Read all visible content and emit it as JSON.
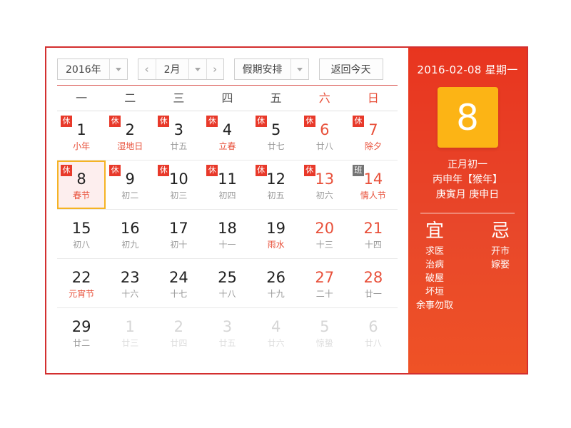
{
  "toolbar": {
    "year_value": "2016年",
    "year_caret": "caret-down-icon",
    "prev_label": "‹",
    "month_value": "2月",
    "month_caret": "caret-down-icon",
    "next_label": "›",
    "holiday_value": "假期安排",
    "holiday_caret": "caret-down-icon",
    "today_label": "返回今天"
  },
  "week_header": [
    {
      "label": "一",
      "weekend": false
    },
    {
      "label": "二",
      "weekend": false
    },
    {
      "label": "三",
      "weekend": false
    },
    {
      "label": "四",
      "weekend": false
    },
    {
      "label": "五",
      "weekend": false
    },
    {
      "label": "六",
      "weekend": true
    },
    {
      "label": "日",
      "weekend": true
    }
  ],
  "weeks": [
    [
      {
        "num": "1",
        "lunar": "小年",
        "lunar_fest": true,
        "badge": "休",
        "badge_type": "rest",
        "weekend": false,
        "other": false,
        "selected": false
      },
      {
        "num": "2",
        "lunar": "湿地日",
        "lunar_fest": true,
        "badge": "休",
        "badge_type": "rest",
        "weekend": false,
        "other": false,
        "selected": false
      },
      {
        "num": "3",
        "lunar": "廿五",
        "lunar_fest": false,
        "badge": "休",
        "badge_type": "rest",
        "weekend": false,
        "other": false,
        "selected": false
      },
      {
        "num": "4",
        "lunar": "立春",
        "lunar_fest": true,
        "badge": "休",
        "badge_type": "rest",
        "weekend": false,
        "other": false,
        "selected": false
      },
      {
        "num": "5",
        "lunar": "廿七",
        "lunar_fest": false,
        "badge": "休",
        "badge_type": "rest",
        "weekend": false,
        "other": false,
        "selected": false
      },
      {
        "num": "6",
        "lunar": "廿八",
        "lunar_fest": false,
        "badge": "休",
        "badge_type": "rest",
        "weekend": true,
        "other": false,
        "selected": false
      },
      {
        "num": "7",
        "lunar": "除夕",
        "lunar_fest": true,
        "badge": "休",
        "badge_type": "rest",
        "weekend": true,
        "other": false,
        "selected": false
      }
    ],
    [
      {
        "num": "8",
        "lunar": "春节",
        "lunar_fest": true,
        "badge": "休",
        "badge_type": "rest",
        "weekend": false,
        "other": false,
        "selected": true
      },
      {
        "num": "9",
        "lunar": "初二",
        "lunar_fest": false,
        "badge": "休",
        "badge_type": "rest",
        "weekend": false,
        "other": false,
        "selected": false
      },
      {
        "num": "10",
        "lunar": "初三",
        "lunar_fest": false,
        "badge": "休",
        "badge_type": "rest",
        "weekend": false,
        "other": false,
        "selected": false
      },
      {
        "num": "11",
        "lunar": "初四",
        "lunar_fest": false,
        "badge": "休",
        "badge_type": "rest",
        "weekend": false,
        "other": false,
        "selected": false
      },
      {
        "num": "12",
        "lunar": "初五",
        "lunar_fest": false,
        "badge": "休",
        "badge_type": "rest",
        "weekend": false,
        "other": false,
        "selected": false
      },
      {
        "num": "13",
        "lunar": "初六",
        "lunar_fest": false,
        "badge": "休",
        "badge_type": "rest",
        "weekend": true,
        "other": false,
        "selected": false
      },
      {
        "num": "14",
        "lunar": "情人节",
        "lunar_fest": true,
        "badge": "班",
        "badge_type": "work",
        "weekend": true,
        "other": false,
        "selected": false
      }
    ],
    [
      {
        "num": "15",
        "lunar": "初八",
        "lunar_fest": false,
        "badge": "",
        "badge_type": "",
        "weekend": false,
        "other": false,
        "selected": false
      },
      {
        "num": "16",
        "lunar": "初九",
        "lunar_fest": false,
        "badge": "",
        "badge_type": "",
        "weekend": false,
        "other": false,
        "selected": false
      },
      {
        "num": "17",
        "lunar": "初十",
        "lunar_fest": false,
        "badge": "",
        "badge_type": "",
        "weekend": false,
        "other": false,
        "selected": false
      },
      {
        "num": "18",
        "lunar": "十一",
        "lunar_fest": false,
        "badge": "",
        "badge_type": "",
        "weekend": false,
        "other": false,
        "selected": false
      },
      {
        "num": "19",
        "lunar": "雨水",
        "lunar_fest": true,
        "badge": "",
        "badge_type": "",
        "weekend": false,
        "other": false,
        "selected": false
      },
      {
        "num": "20",
        "lunar": "十三",
        "lunar_fest": false,
        "badge": "",
        "badge_type": "",
        "weekend": true,
        "other": false,
        "selected": false
      },
      {
        "num": "21",
        "lunar": "十四",
        "lunar_fest": false,
        "badge": "",
        "badge_type": "",
        "weekend": true,
        "other": false,
        "selected": false
      }
    ],
    [
      {
        "num": "22",
        "lunar": "元宵节",
        "lunar_fest": true,
        "badge": "",
        "badge_type": "",
        "weekend": false,
        "other": false,
        "selected": false
      },
      {
        "num": "23",
        "lunar": "十六",
        "lunar_fest": false,
        "badge": "",
        "badge_type": "",
        "weekend": false,
        "other": false,
        "selected": false
      },
      {
        "num": "24",
        "lunar": "十七",
        "lunar_fest": false,
        "badge": "",
        "badge_type": "",
        "weekend": false,
        "other": false,
        "selected": false
      },
      {
        "num": "25",
        "lunar": "十八",
        "lunar_fest": false,
        "badge": "",
        "badge_type": "",
        "weekend": false,
        "other": false,
        "selected": false
      },
      {
        "num": "26",
        "lunar": "十九",
        "lunar_fest": false,
        "badge": "",
        "badge_type": "",
        "weekend": false,
        "other": false,
        "selected": false
      },
      {
        "num": "27",
        "lunar": "二十",
        "lunar_fest": false,
        "badge": "",
        "badge_type": "",
        "weekend": true,
        "other": false,
        "selected": false
      },
      {
        "num": "28",
        "lunar": "廿一",
        "lunar_fest": false,
        "badge": "",
        "badge_type": "",
        "weekend": true,
        "other": false,
        "selected": false
      }
    ],
    [
      {
        "num": "29",
        "lunar": "廿二",
        "lunar_fest": false,
        "badge": "",
        "badge_type": "",
        "weekend": false,
        "other": false,
        "selected": false
      },
      {
        "num": "1",
        "lunar": "廿三",
        "lunar_fest": false,
        "badge": "",
        "badge_type": "",
        "weekend": false,
        "other": true,
        "selected": false
      },
      {
        "num": "2",
        "lunar": "廿四",
        "lunar_fest": false,
        "badge": "",
        "badge_type": "",
        "weekend": false,
        "other": true,
        "selected": false
      },
      {
        "num": "3",
        "lunar": "廿五",
        "lunar_fest": false,
        "badge": "",
        "badge_type": "",
        "weekend": false,
        "other": true,
        "selected": false
      },
      {
        "num": "4",
        "lunar": "廿六",
        "lunar_fest": false,
        "badge": "",
        "badge_type": "",
        "weekend": false,
        "other": true,
        "selected": false
      },
      {
        "num": "5",
        "lunar": "惊蛰",
        "lunar_fest": false,
        "badge": "",
        "badge_type": "",
        "weekend": false,
        "other": true,
        "selected": false
      },
      {
        "num": "6",
        "lunar": "廿八",
        "lunar_fest": false,
        "badge": "",
        "badge_type": "",
        "weekend": false,
        "other": true,
        "selected": false
      }
    ]
  ],
  "detail_panel": {
    "date_line": "2016-02-08 星期一",
    "day_number": "8",
    "lunar_day": "正月初一",
    "ganzhi_year": "丙申年【猴年】",
    "ganzhi_month_day": "庚寅月 庚申日",
    "yi_title": "宜",
    "yi_items": [
      "求医",
      "治病",
      "破屋",
      "坏垣",
      "余事勿取"
    ],
    "ji_title": "忌",
    "ji_items": [
      "开市",
      "嫁娶"
    ]
  },
  "colors": {
    "frame_red": "#d32f2f",
    "panel_red": "#e8442a",
    "accent_orange": "#fcb415",
    "rest_badge": "#e8392a",
    "work_badge": "#757575",
    "selected_border": "#f5b324",
    "selected_bg": "#fdeeee"
  }
}
